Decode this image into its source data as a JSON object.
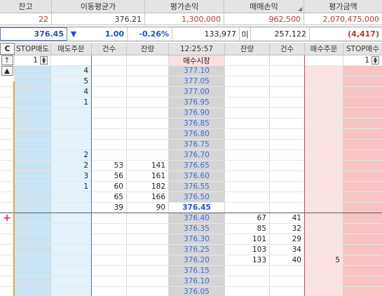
{
  "summary": {
    "headers": [
      "잔고",
      "이동평균가",
      "평가손익",
      "매매손익",
      "평가금액"
    ],
    "values": [
      "22",
      "376.21",
      "1,300,000",
      "962,500",
      "2,070,475,000"
    ]
  },
  "price_line": {
    "current": "376.45",
    "direction_arrow": "▼",
    "change": "1.00",
    "change_rate": "-0.26%",
    "volume": "133,977",
    "unit_label": "미",
    "volume2": "257,122",
    "diff": "(4,417)"
  },
  "grid": {
    "headers": {
      "c_button": "C",
      "stop_sell": "STOP매도",
      "sell_order": "매도주문",
      "ask_count": "건수",
      "ask_remain": "잔량",
      "time": "12:25:57",
      "bid_remain": "잔량",
      "bid_count": "건수",
      "buy_order": "매수주문",
      "stop_buy": "STOP매수"
    },
    "control_row": {
      "up_button": "↑",
      "left_spin": "1",
      "market_label": "매수시장",
      "right_spin": "1"
    },
    "side_buttons": {
      "up_arrow": "▲",
      "plus": "+"
    },
    "ask_rows": [
      {
        "sell_order": "4",
        "ask_count": "",
        "ask_remain": "",
        "price": "377.10"
      },
      {
        "sell_order": "5",
        "ask_count": "",
        "ask_remain": "",
        "price": "377.05"
      },
      {
        "sell_order": "4",
        "ask_count": "",
        "ask_remain": "",
        "price": "377.00"
      },
      {
        "sell_order": "1",
        "ask_count": "",
        "ask_remain": "",
        "price": "376.95"
      },
      {
        "sell_order": "",
        "ask_count": "",
        "ask_remain": "",
        "price": "376.90"
      },
      {
        "sell_order": "",
        "ask_count": "",
        "ask_remain": "",
        "price": "376.85"
      },
      {
        "sell_order": "",
        "ask_count": "",
        "ask_remain": "",
        "price": "376.80"
      },
      {
        "sell_order": "",
        "ask_count": "",
        "ask_remain": "",
        "price": "376.75"
      },
      {
        "sell_order": "2",
        "ask_count": "",
        "ask_remain": "",
        "price": "376.70"
      },
      {
        "sell_order": "2",
        "ask_count": "53",
        "ask_remain": "141",
        "price": "376.65"
      },
      {
        "sell_order": "3",
        "ask_count": "56",
        "ask_remain": "161",
        "price": "376.60"
      },
      {
        "sell_order": "1",
        "ask_count": "60",
        "ask_remain": "182",
        "price": "376.55"
      },
      {
        "sell_order": "",
        "ask_count": "65",
        "ask_remain": "166",
        "price": "376.50"
      }
    ],
    "current_row": {
      "ask_count": "39",
      "ask_remain": "90",
      "price": "376.45"
    },
    "bid_rows": [
      {
        "price": "376.40",
        "bid_remain": "67",
        "bid_count": "41",
        "buy_order": ""
      },
      {
        "price": "376.35",
        "bid_remain": "85",
        "bid_count": "32",
        "buy_order": ""
      },
      {
        "price": "376.30",
        "bid_remain": "101",
        "bid_count": "29",
        "buy_order": ""
      },
      {
        "price": "376.25",
        "bid_remain": "103",
        "bid_count": "34",
        "buy_order": ""
      },
      {
        "price": "376.20",
        "bid_remain": "133",
        "bid_count": "40",
        "buy_order": "5"
      },
      {
        "price": "376.15",
        "bid_remain": "",
        "bid_count": "",
        "buy_order": ""
      },
      {
        "price": "376.10",
        "bid_remain": "",
        "bid_count": "",
        "buy_order": ""
      },
      {
        "price": "376.05",
        "bid_remain": "",
        "bid_count": "",
        "buy_order": ""
      }
    ]
  },
  "colors": {
    "price_blue": "#3d6cd4",
    "current_blue": "#1f4fcf",
    "loss_red": "#c0392b",
    "sell_bg": "#c9e4f4",
    "buy_bg": "#f8c3c3"
  }
}
